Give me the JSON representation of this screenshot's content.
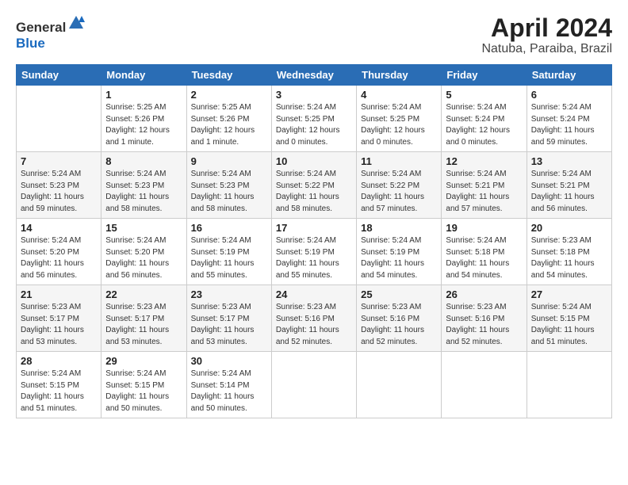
{
  "header": {
    "logo_general": "General",
    "logo_blue": "Blue",
    "month": "April 2024",
    "location": "Natuba, Paraiba, Brazil"
  },
  "calendar": {
    "days_of_week": [
      "Sunday",
      "Monday",
      "Tuesday",
      "Wednesday",
      "Thursday",
      "Friday",
      "Saturday"
    ],
    "weeks": [
      [
        {
          "day": "",
          "info": ""
        },
        {
          "day": "1",
          "info": "Sunrise: 5:25 AM\nSunset: 5:26 PM\nDaylight: 12 hours\nand 1 minute."
        },
        {
          "day": "2",
          "info": "Sunrise: 5:25 AM\nSunset: 5:26 PM\nDaylight: 12 hours\nand 1 minute."
        },
        {
          "day": "3",
          "info": "Sunrise: 5:24 AM\nSunset: 5:25 PM\nDaylight: 12 hours\nand 0 minutes."
        },
        {
          "day": "4",
          "info": "Sunrise: 5:24 AM\nSunset: 5:25 PM\nDaylight: 12 hours\nand 0 minutes."
        },
        {
          "day": "5",
          "info": "Sunrise: 5:24 AM\nSunset: 5:24 PM\nDaylight: 12 hours\nand 0 minutes."
        },
        {
          "day": "6",
          "info": "Sunrise: 5:24 AM\nSunset: 5:24 PM\nDaylight: 11 hours\nand 59 minutes."
        }
      ],
      [
        {
          "day": "7",
          "info": "Sunrise: 5:24 AM\nSunset: 5:23 PM\nDaylight: 11 hours\nand 59 minutes."
        },
        {
          "day": "8",
          "info": "Sunrise: 5:24 AM\nSunset: 5:23 PM\nDaylight: 11 hours\nand 58 minutes."
        },
        {
          "day": "9",
          "info": "Sunrise: 5:24 AM\nSunset: 5:23 PM\nDaylight: 11 hours\nand 58 minutes."
        },
        {
          "day": "10",
          "info": "Sunrise: 5:24 AM\nSunset: 5:22 PM\nDaylight: 11 hours\nand 58 minutes."
        },
        {
          "day": "11",
          "info": "Sunrise: 5:24 AM\nSunset: 5:22 PM\nDaylight: 11 hours\nand 57 minutes."
        },
        {
          "day": "12",
          "info": "Sunrise: 5:24 AM\nSunset: 5:21 PM\nDaylight: 11 hours\nand 57 minutes."
        },
        {
          "day": "13",
          "info": "Sunrise: 5:24 AM\nSunset: 5:21 PM\nDaylight: 11 hours\nand 56 minutes."
        }
      ],
      [
        {
          "day": "14",
          "info": "Sunrise: 5:24 AM\nSunset: 5:20 PM\nDaylight: 11 hours\nand 56 minutes."
        },
        {
          "day": "15",
          "info": "Sunrise: 5:24 AM\nSunset: 5:20 PM\nDaylight: 11 hours\nand 56 minutes."
        },
        {
          "day": "16",
          "info": "Sunrise: 5:24 AM\nSunset: 5:19 PM\nDaylight: 11 hours\nand 55 minutes."
        },
        {
          "day": "17",
          "info": "Sunrise: 5:24 AM\nSunset: 5:19 PM\nDaylight: 11 hours\nand 55 minutes."
        },
        {
          "day": "18",
          "info": "Sunrise: 5:24 AM\nSunset: 5:19 PM\nDaylight: 11 hours\nand 54 minutes."
        },
        {
          "day": "19",
          "info": "Sunrise: 5:24 AM\nSunset: 5:18 PM\nDaylight: 11 hours\nand 54 minutes."
        },
        {
          "day": "20",
          "info": "Sunrise: 5:23 AM\nSunset: 5:18 PM\nDaylight: 11 hours\nand 54 minutes."
        }
      ],
      [
        {
          "day": "21",
          "info": "Sunrise: 5:23 AM\nSunset: 5:17 PM\nDaylight: 11 hours\nand 53 minutes."
        },
        {
          "day": "22",
          "info": "Sunrise: 5:23 AM\nSunset: 5:17 PM\nDaylight: 11 hours\nand 53 minutes."
        },
        {
          "day": "23",
          "info": "Sunrise: 5:23 AM\nSunset: 5:17 PM\nDaylight: 11 hours\nand 53 minutes."
        },
        {
          "day": "24",
          "info": "Sunrise: 5:23 AM\nSunset: 5:16 PM\nDaylight: 11 hours\nand 52 minutes."
        },
        {
          "day": "25",
          "info": "Sunrise: 5:23 AM\nSunset: 5:16 PM\nDaylight: 11 hours\nand 52 minutes."
        },
        {
          "day": "26",
          "info": "Sunrise: 5:23 AM\nSunset: 5:16 PM\nDaylight: 11 hours\nand 52 minutes."
        },
        {
          "day": "27",
          "info": "Sunrise: 5:24 AM\nSunset: 5:15 PM\nDaylight: 11 hours\nand 51 minutes."
        }
      ],
      [
        {
          "day": "28",
          "info": "Sunrise: 5:24 AM\nSunset: 5:15 PM\nDaylight: 11 hours\nand 51 minutes."
        },
        {
          "day": "29",
          "info": "Sunrise: 5:24 AM\nSunset: 5:15 PM\nDaylight: 11 hours\nand 50 minutes."
        },
        {
          "day": "30",
          "info": "Sunrise: 5:24 AM\nSunset: 5:14 PM\nDaylight: 11 hours\nand 50 minutes."
        },
        {
          "day": "",
          "info": ""
        },
        {
          "day": "",
          "info": ""
        },
        {
          "day": "",
          "info": ""
        },
        {
          "day": "",
          "info": ""
        }
      ]
    ]
  }
}
